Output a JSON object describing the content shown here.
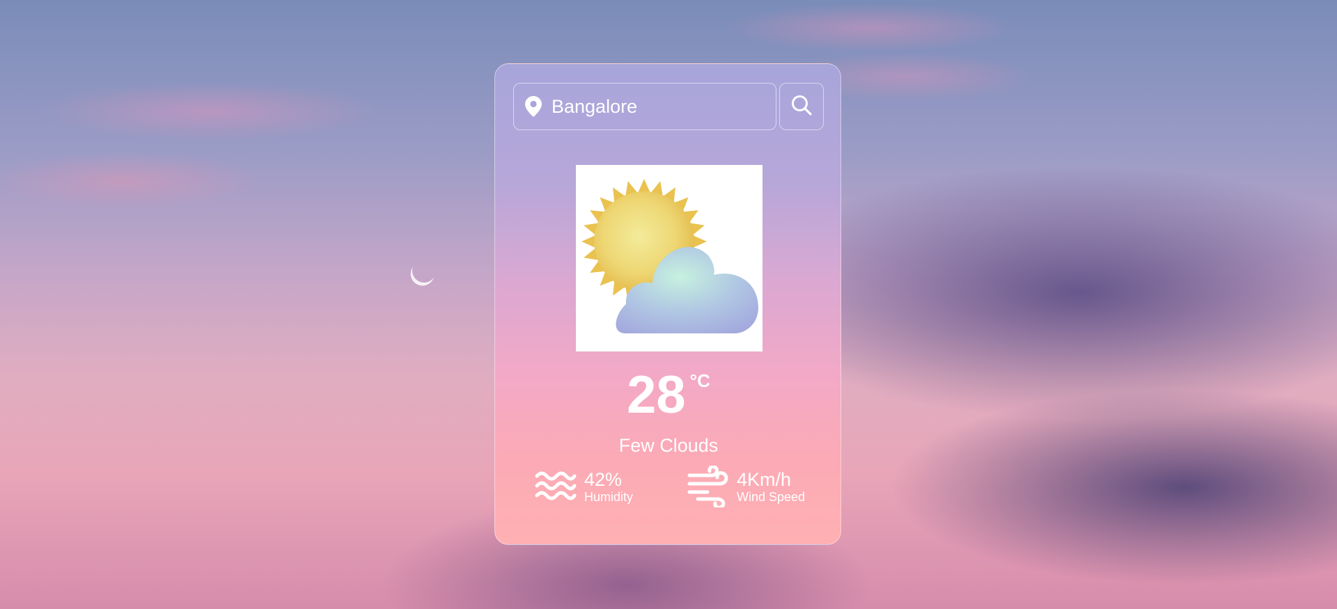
{
  "search": {
    "value": "Bangalore",
    "pin_icon": "location-pin-icon",
    "button_icon": "search-icon"
  },
  "weather": {
    "icon": "sun-behind-cloud-icon",
    "temperature": "28",
    "unit": "°C",
    "description": "Few Clouds"
  },
  "stats": {
    "humidity_value": "42%",
    "humidity_label": "Humidity",
    "humidity_icon": "water-waves-icon",
    "wind_value": "4Km/h",
    "wind_label": "Wind Speed",
    "wind_icon": "wind-icon"
  },
  "colors": {
    "text": "#ffffff",
    "card_top": "#a7a5da",
    "card_bottom": "#ffb0b2"
  }
}
